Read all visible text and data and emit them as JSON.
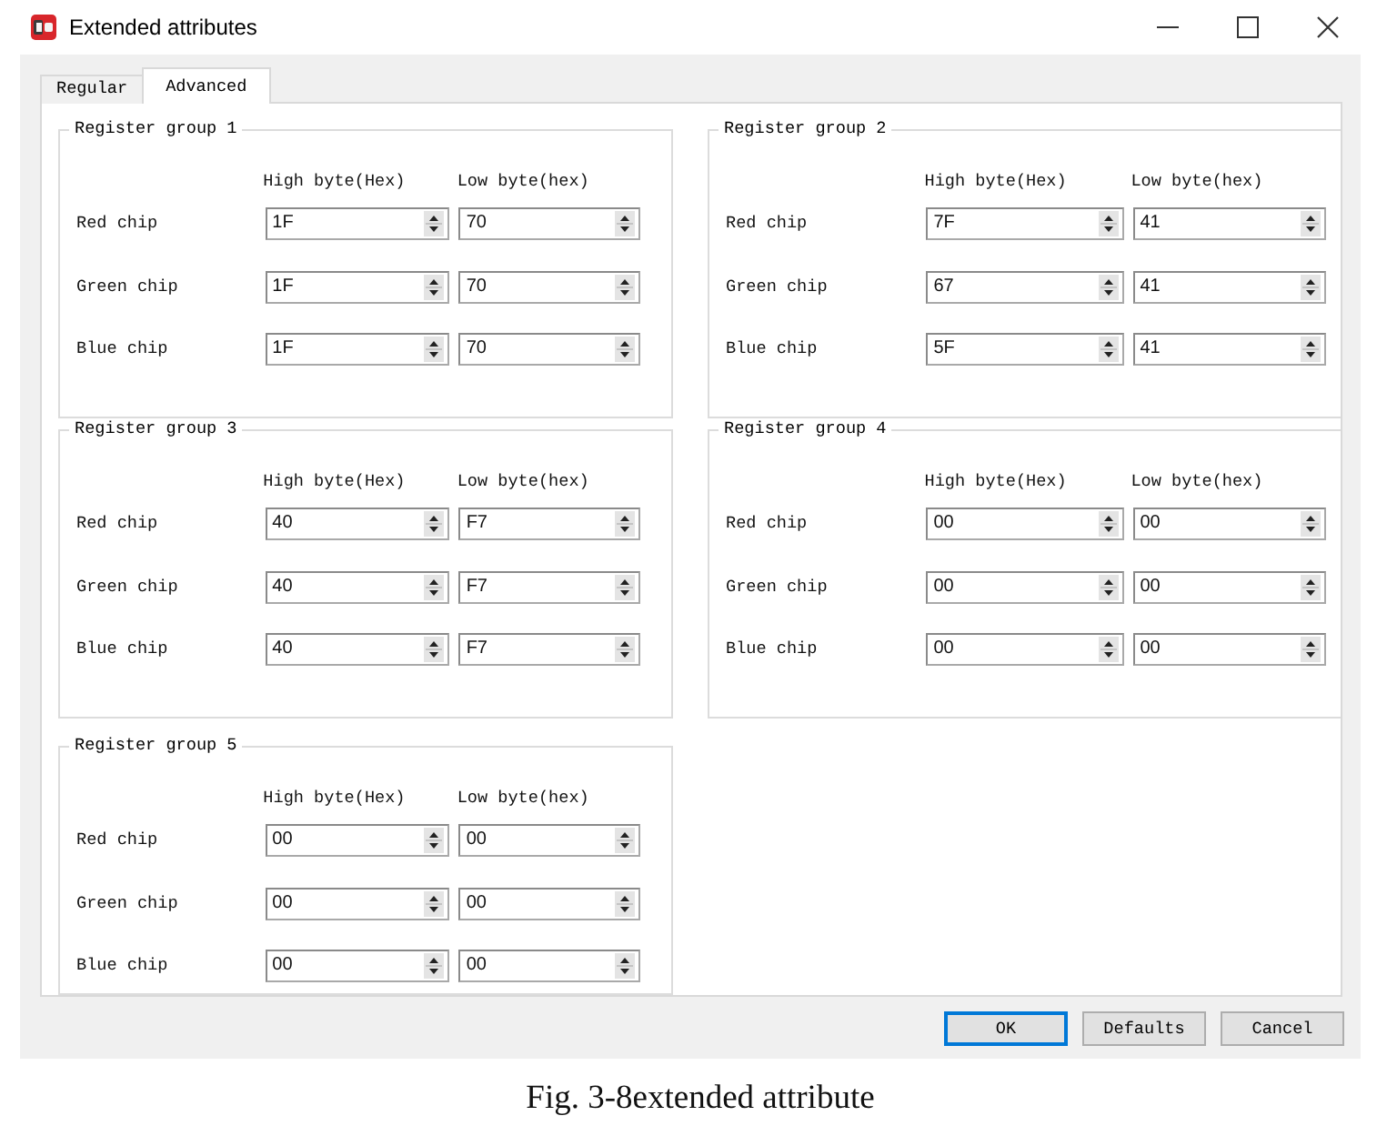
{
  "window": {
    "title": "Extended attributes"
  },
  "tabs": [
    {
      "label": "Regular",
      "selected": false
    },
    {
      "label": "Advanced",
      "selected": true
    }
  ],
  "register_groups": [
    {
      "title": "Register group 1",
      "columns": [
        "High byte(Hex)",
        "Low byte(hex)"
      ],
      "rows": [
        {
          "label": "Red chip",
          "high_byte": "1F",
          "low_byte": "70"
        },
        {
          "label": "Green chip",
          "high_byte": "1F",
          "low_byte": "70"
        },
        {
          "label": "Blue chip",
          "high_byte": "1F",
          "low_byte": "70"
        }
      ]
    },
    {
      "title": "Register group 2",
      "columns": [
        "High byte(Hex)",
        "Low byte(hex)"
      ],
      "rows": [
        {
          "label": "Red chip",
          "high_byte": "7F",
          "low_byte": "41"
        },
        {
          "label": "Green chip",
          "high_byte": "67",
          "low_byte": "41"
        },
        {
          "label": "Blue chip",
          "high_byte": "5F",
          "low_byte": "41"
        }
      ]
    },
    {
      "title": "Register group 3",
      "columns": [
        "High byte(Hex)",
        "Low byte(hex)"
      ],
      "rows": [
        {
          "label": "Red chip",
          "high_byte": "40",
          "low_byte": "F7"
        },
        {
          "label": "Green chip",
          "high_byte": "40",
          "low_byte": "F7"
        },
        {
          "label": "Blue chip",
          "high_byte": "40",
          "low_byte": "F7"
        }
      ]
    },
    {
      "title": "Register group 4",
      "columns": [
        "High byte(Hex)",
        "Low byte(hex)"
      ],
      "rows": [
        {
          "label": "Red chip",
          "high_byte": "00",
          "low_byte": "00"
        },
        {
          "label": "Green chip",
          "high_byte": "00",
          "low_byte": "00"
        },
        {
          "label": "Blue chip",
          "high_byte": "00",
          "low_byte": "00"
        }
      ]
    },
    {
      "title": "Register group 5",
      "columns": [
        "High byte(Hex)",
        "Low byte(hex)"
      ],
      "rows": [
        {
          "label": "Red chip",
          "high_byte": "00",
          "low_byte": "00"
        },
        {
          "label": "Green chip",
          "high_byte": "00",
          "low_byte": "00"
        },
        {
          "label": "Blue chip",
          "high_byte": "00",
          "low_byte": "00"
        }
      ]
    }
  ],
  "buttons": [
    {
      "label": "OK",
      "focused": true
    },
    {
      "label": "Defaults",
      "focused": false
    },
    {
      "label": "Cancel",
      "focused": false
    }
  ],
  "caption": "Fig. 3-8extended attribute"
}
